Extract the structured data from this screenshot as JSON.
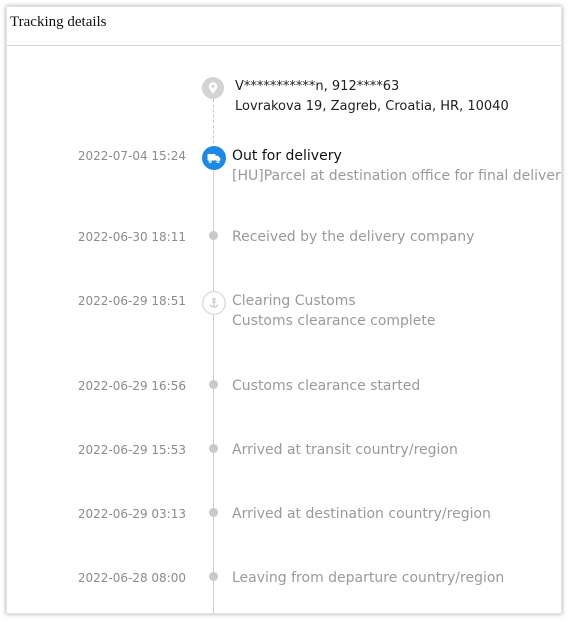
{
  "panel": {
    "title": "Tracking details"
  },
  "address": {
    "recipient": "V***********n,  912****63",
    "street": "Lovrakova 19,  Zagreb,  Croatia,  HR,  10040"
  },
  "colors": {
    "accent": "#1e88e5",
    "dot": "#c9c9c9",
    "muted_text": "#9a9a9a",
    "time_text": "#8c8c8c"
  },
  "events": [
    {
      "time": "2022-07-04 15:24",
      "title": "Out for delivery",
      "detail": "[HU]Parcel at destination office for final delivery",
      "icon": "truck-icon",
      "active": true
    },
    {
      "time": "2022-06-30 18:11",
      "title": "Received by the delivery company",
      "icon": "dot-icon"
    },
    {
      "time": "2022-06-29 18:51",
      "title": "Clearing Customs",
      "detail": "Customs clearance complete",
      "icon": "anchor-icon"
    },
    {
      "time": "2022-06-29 16:56",
      "title": "Customs clearance started",
      "icon": "dot-icon"
    },
    {
      "time": "2022-06-29 15:53",
      "title": "Arrived at transit country/region",
      "icon": "dot-icon"
    },
    {
      "time": "2022-06-29 03:13",
      "title": "Arrived at destination country/region",
      "icon": "dot-icon"
    },
    {
      "time": "2022-06-28 08:00",
      "title": "Leaving from departure country/region",
      "icon": "dot-icon"
    }
  ]
}
